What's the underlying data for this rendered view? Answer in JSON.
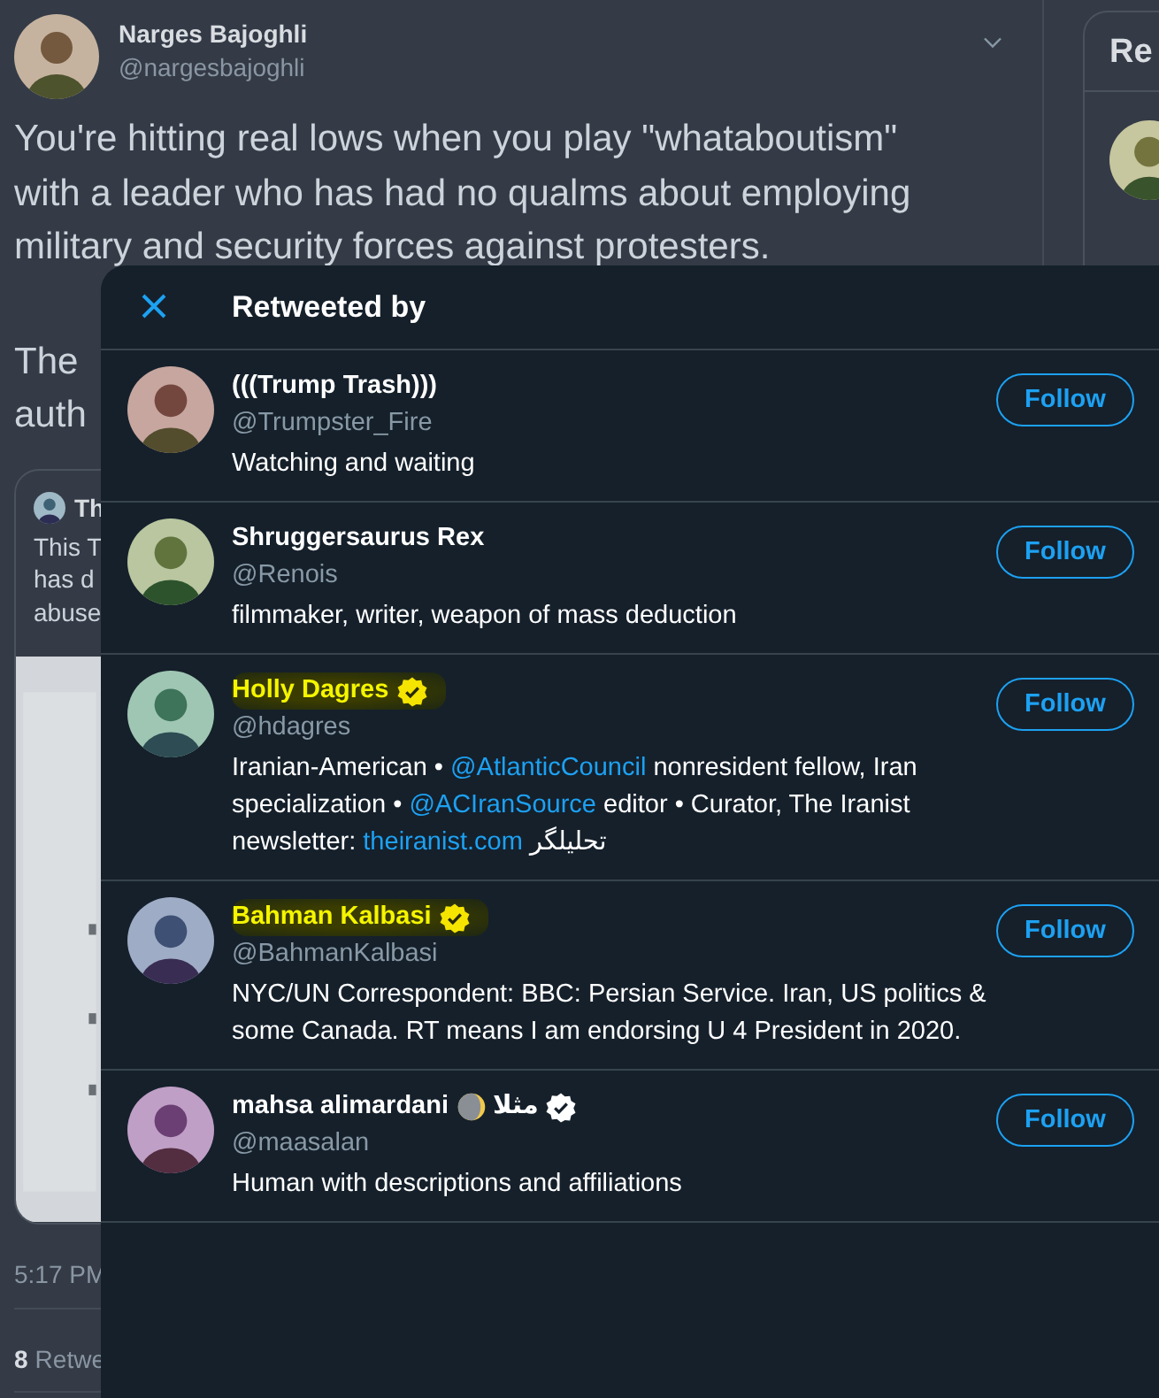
{
  "tweet": {
    "author": {
      "name": "Narges Bajoghli",
      "handle": "@nargesbajoghli"
    },
    "paragraphs": [
      [
        "You're hitting real lows when you play \"whataboutism\"",
        "with a leader who has had no qualms about employing",
        "military and security forces against protesters."
      ],
      [
        "The",
        "auth"
      ]
    ],
    "quote": {
      "name": "Th",
      "lines": [
        "This T",
        "has d",
        "abuse"
      ]
    },
    "time": "5:17 PM",
    "retweet_count": "8",
    "retweet_label": "Retwe"
  },
  "side_panel": {
    "title": "Re"
  },
  "modal": {
    "title": "Retweeted by",
    "users": [
      {
        "name": "(((Trump Trash)))",
        "handle": "@Trumpster_Fire",
        "verified": false,
        "highlighted": false,
        "bio": [
          {
            "kind": "text",
            "text": "Watching and waiting"
          }
        ],
        "button": "Follow"
      },
      {
        "name": "Shruggersaurus Rex",
        "handle": "@Renois",
        "verified": false,
        "highlighted": false,
        "bio": [
          {
            "kind": "text",
            "text": "filmmaker, writer, weapon of mass deduction"
          }
        ],
        "button": "Follow"
      },
      {
        "name": "Holly Dagres",
        "handle": "@hdagres",
        "verified": true,
        "highlighted": true,
        "bio": [
          {
            "kind": "text",
            "text": "Iranian-American •"
          },
          {
            "kind": "link",
            "text": "@AtlanticCouncil"
          },
          {
            "kind": "text",
            "text": "nonresident fellow, Iran specialization •"
          },
          {
            "kind": "link",
            "text": "@ACIranSource"
          },
          {
            "kind": "text",
            "text": "editor • Curator, The Iranist newsletter:"
          },
          {
            "kind": "link",
            "text": "theiranist.com"
          },
          {
            "kind": "text",
            "text": "تحلیلگر"
          }
        ],
        "button": "Follow"
      },
      {
        "name": "Bahman Kalbasi",
        "handle": "@BahmanKalbasi",
        "verified": true,
        "highlighted": true,
        "bio": [
          {
            "kind": "text",
            "text": "NYC/UN Correspondent: BBC: Persian Service. Iran, US politics & some Canada. RT means I am endorsing U 4 President in 2020."
          }
        ],
        "button": "Follow"
      },
      {
        "name": "mahsa alimardani",
        "moon": true,
        "name_suffix": "مثلا",
        "handle": "@maasalan",
        "verified": true,
        "highlighted": false,
        "bio": [
          {
            "kind": "text",
            "text": "Human with descriptions and affiliations"
          }
        ],
        "button": "Follow"
      }
    ]
  }
}
